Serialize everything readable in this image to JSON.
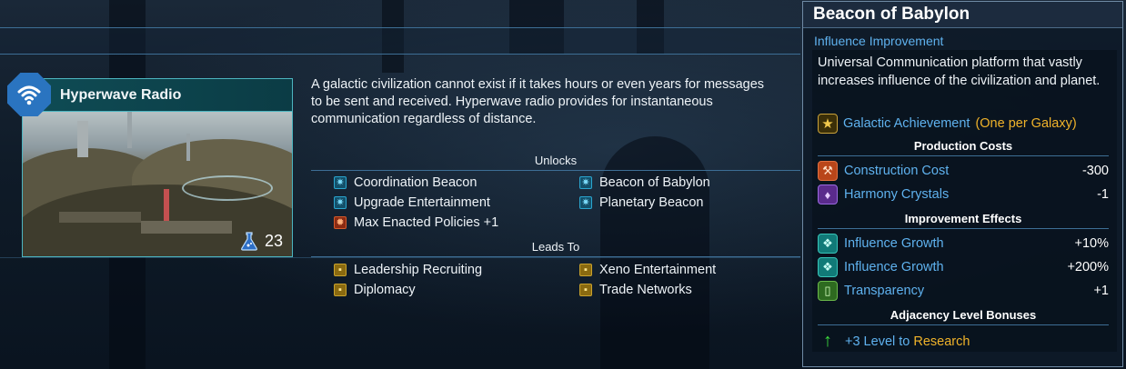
{
  "tech": {
    "name": "Hyperwave Radio",
    "research_cost": "23",
    "description": "A galactic civilization cannot exist if it takes hours or even years for messages to be sent and received. Hyperwave radio provides for instantaneous communication regardless of distance."
  },
  "unlocks": {
    "title": "Unlocks",
    "items": [
      {
        "label": "Coordination Beacon",
        "kind": "improvement"
      },
      {
        "label": "Beacon of Babylon",
        "kind": "improvement"
      },
      {
        "label": "Upgrade Entertainment",
        "kind": "improvement"
      },
      {
        "label": "Planetary Beacon",
        "kind": "improvement"
      },
      {
        "label": "Max Enacted Policies +1",
        "kind": "policy"
      }
    ]
  },
  "leads_to": {
    "title": "Leads To",
    "items": [
      {
        "label": "Leadership Recruiting"
      },
      {
        "label": "Xeno Entertainment"
      },
      {
        "label": "Diplomacy"
      },
      {
        "label": "Trade Networks"
      }
    ]
  },
  "tooltip": {
    "title": "Beacon of Babylon",
    "subtitle": "Influence Improvement",
    "description": "Universal Communication platform that vastly increases influence of the civilization and planet.",
    "achievement": "Galactic Achievement",
    "achievement_note": "(One per Galaxy)",
    "production_title": "Production Costs",
    "production": [
      {
        "label": "Construction Cost",
        "value": "-300",
        "icon": "hammer-icon"
      },
      {
        "label": "Harmony Crystals",
        "value": "-1",
        "icon": "crystal-icon"
      }
    ],
    "effects_title": "Improvement Effects",
    "effects": [
      {
        "label": "Influence Growth",
        "value": "+10%",
        "icon": "influence-icon"
      },
      {
        "label": "Influence Growth",
        "value": "+200%",
        "icon": "influence-icon"
      },
      {
        "label": "Transparency",
        "value": "+1",
        "icon": "transparency-icon"
      }
    ],
    "adjacency_title": "Adjacency Level Bonuses",
    "adjacency_value": "+3 Level to",
    "adjacency_target": "Research"
  },
  "colors": {
    "accent_blue": "#5fb2ef",
    "gold": "#f0b32a",
    "card_border": "#4cb5c0",
    "wifi_badge": "#2a74c0"
  }
}
